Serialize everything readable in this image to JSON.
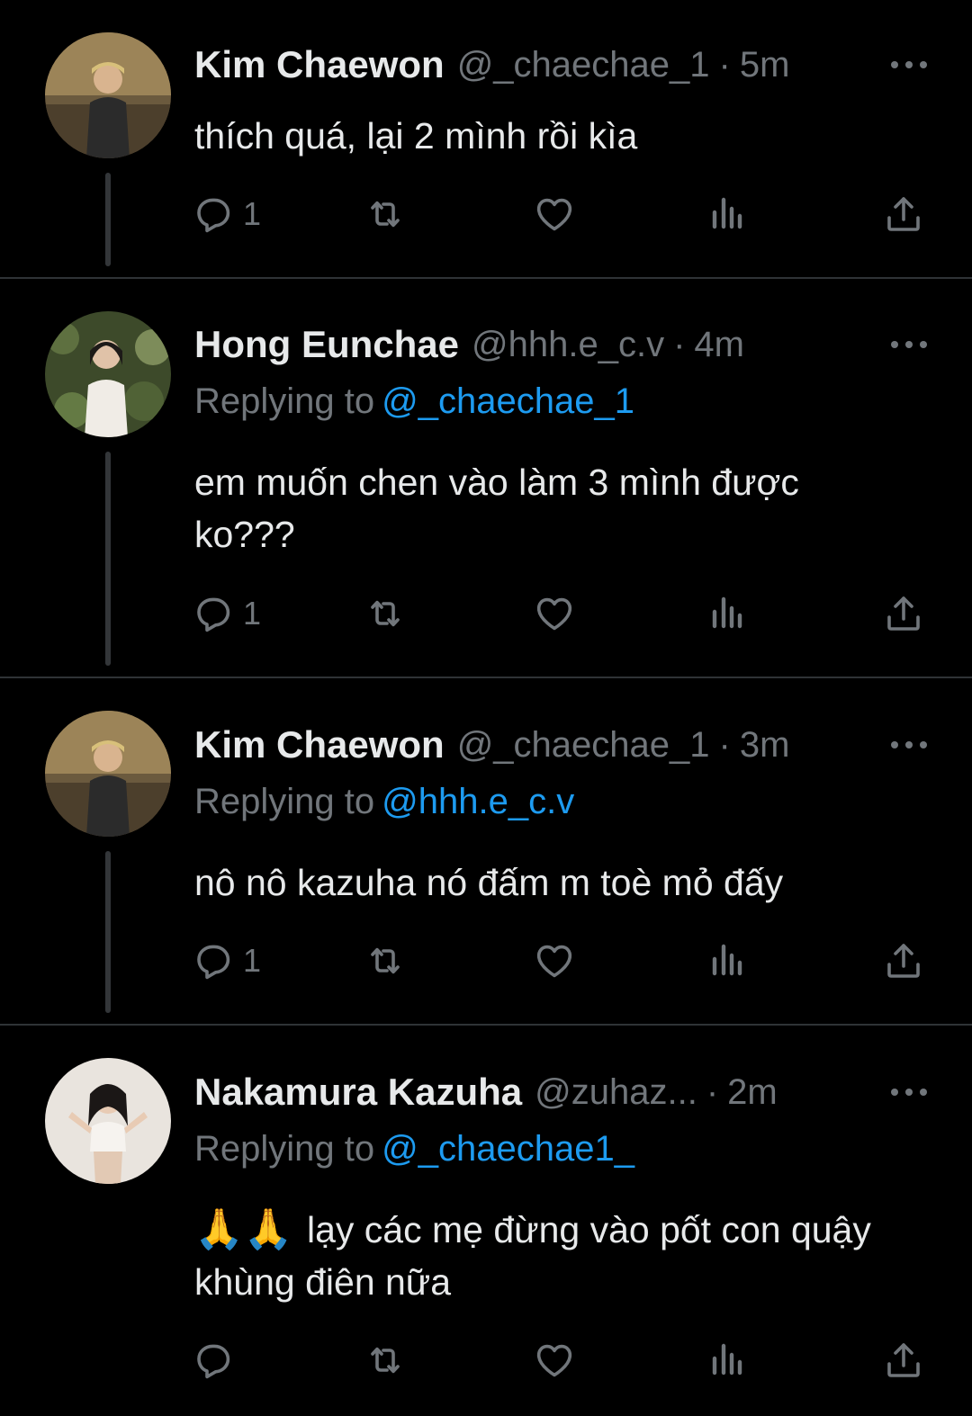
{
  "colors": {
    "background": "#000000",
    "text_primary": "#e7e9ea",
    "text_secondary": "#71767b",
    "mention": "#1d9bf0",
    "divider": "#2f3336"
  },
  "tweets": [
    {
      "name": "Kim Chaewon",
      "handle": "@_chaechae_1",
      "time": "5m",
      "replying_label": "",
      "replying_to": "",
      "text": "thích quá, lại 2 mình rồi kìa",
      "reply_count": "1",
      "avatar_icon": "avatar-photo"
    },
    {
      "name": "Hong Eunchae",
      "handle": "@hhh.e_c.v",
      "time": "4m",
      "replying_label": "Replying to",
      "replying_to": "@_chaechae_1",
      "text_line1": "em muốn chen vào làm 3 mình được",
      "text_line2": "ko???",
      "reply_count": "1",
      "avatar_icon": "avatar-photo"
    },
    {
      "name": "Kim Chaewon",
      "handle": "@_chaechae_1",
      "time": "3m",
      "replying_label": "Replying to",
      "replying_to": "@hhh.e_c.v",
      "text": "nô nô kazuha nó đấm m toè mỏ đấy",
      "reply_count": "1",
      "avatar_icon": "avatar-photo"
    },
    {
      "name": "Nakamura Kazuha",
      "handle": "@zuhaz...",
      "time": "2m",
      "replying_label": "Replying to",
      "replying_to": "@_chaechae1_",
      "emoji": "🙏🙏",
      "text_line1": "lạy các mẹ đừng vào pốt con quậy",
      "text_line2": "khùng điên nữa",
      "reply_count": "",
      "avatar_icon": "avatar-photo"
    }
  ],
  "separator": "·",
  "icons": [
    "reply-icon",
    "retweet-icon",
    "like-icon",
    "views-icon",
    "share-icon",
    "more-icon"
  ]
}
